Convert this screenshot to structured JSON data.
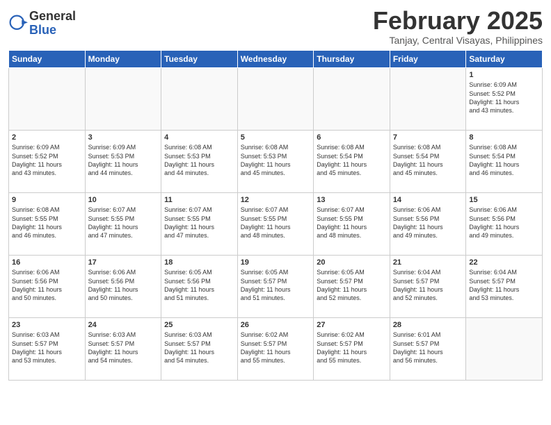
{
  "header": {
    "logo_general": "General",
    "logo_blue": "Blue",
    "month_title": "February 2025",
    "location": "Tanjay, Central Visayas, Philippines"
  },
  "days_of_week": [
    "Sunday",
    "Monday",
    "Tuesday",
    "Wednesday",
    "Thursday",
    "Friday",
    "Saturday"
  ],
  "weeks": [
    [
      {
        "day": "",
        "info": ""
      },
      {
        "day": "",
        "info": ""
      },
      {
        "day": "",
        "info": ""
      },
      {
        "day": "",
        "info": ""
      },
      {
        "day": "",
        "info": ""
      },
      {
        "day": "",
        "info": ""
      },
      {
        "day": "1",
        "info": "Sunrise: 6:09 AM\nSunset: 5:52 PM\nDaylight: 11 hours\nand 43 minutes."
      }
    ],
    [
      {
        "day": "2",
        "info": "Sunrise: 6:09 AM\nSunset: 5:52 PM\nDaylight: 11 hours\nand 43 minutes."
      },
      {
        "day": "3",
        "info": "Sunrise: 6:09 AM\nSunset: 5:53 PM\nDaylight: 11 hours\nand 44 minutes."
      },
      {
        "day": "4",
        "info": "Sunrise: 6:08 AM\nSunset: 5:53 PM\nDaylight: 11 hours\nand 44 minutes."
      },
      {
        "day": "5",
        "info": "Sunrise: 6:08 AM\nSunset: 5:53 PM\nDaylight: 11 hours\nand 45 minutes."
      },
      {
        "day": "6",
        "info": "Sunrise: 6:08 AM\nSunset: 5:54 PM\nDaylight: 11 hours\nand 45 minutes."
      },
      {
        "day": "7",
        "info": "Sunrise: 6:08 AM\nSunset: 5:54 PM\nDaylight: 11 hours\nand 45 minutes."
      },
      {
        "day": "8",
        "info": "Sunrise: 6:08 AM\nSunset: 5:54 PM\nDaylight: 11 hours\nand 46 minutes."
      }
    ],
    [
      {
        "day": "9",
        "info": "Sunrise: 6:08 AM\nSunset: 5:55 PM\nDaylight: 11 hours\nand 46 minutes."
      },
      {
        "day": "10",
        "info": "Sunrise: 6:07 AM\nSunset: 5:55 PM\nDaylight: 11 hours\nand 47 minutes."
      },
      {
        "day": "11",
        "info": "Sunrise: 6:07 AM\nSunset: 5:55 PM\nDaylight: 11 hours\nand 47 minutes."
      },
      {
        "day": "12",
        "info": "Sunrise: 6:07 AM\nSunset: 5:55 PM\nDaylight: 11 hours\nand 48 minutes."
      },
      {
        "day": "13",
        "info": "Sunrise: 6:07 AM\nSunset: 5:55 PM\nDaylight: 11 hours\nand 48 minutes."
      },
      {
        "day": "14",
        "info": "Sunrise: 6:06 AM\nSunset: 5:56 PM\nDaylight: 11 hours\nand 49 minutes."
      },
      {
        "day": "15",
        "info": "Sunrise: 6:06 AM\nSunset: 5:56 PM\nDaylight: 11 hours\nand 49 minutes."
      }
    ],
    [
      {
        "day": "16",
        "info": "Sunrise: 6:06 AM\nSunset: 5:56 PM\nDaylight: 11 hours\nand 50 minutes."
      },
      {
        "day": "17",
        "info": "Sunrise: 6:06 AM\nSunset: 5:56 PM\nDaylight: 11 hours\nand 50 minutes."
      },
      {
        "day": "18",
        "info": "Sunrise: 6:05 AM\nSunset: 5:56 PM\nDaylight: 11 hours\nand 51 minutes."
      },
      {
        "day": "19",
        "info": "Sunrise: 6:05 AM\nSunset: 5:57 PM\nDaylight: 11 hours\nand 51 minutes."
      },
      {
        "day": "20",
        "info": "Sunrise: 6:05 AM\nSunset: 5:57 PM\nDaylight: 11 hours\nand 52 minutes."
      },
      {
        "day": "21",
        "info": "Sunrise: 6:04 AM\nSunset: 5:57 PM\nDaylight: 11 hours\nand 52 minutes."
      },
      {
        "day": "22",
        "info": "Sunrise: 6:04 AM\nSunset: 5:57 PM\nDaylight: 11 hours\nand 53 minutes."
      }
    ],
    [
      {
        "day": "23",
        "info": "Sunrise: 6:03 AM\nSunset: 5:57 PM\nDaylight: 11 hours\nand 53 minutes."
      },
      {
        "day": "24",
        "info": "Sunrise: 6:03 AM\nSunset: 5:57 PM\nDaylight: 11 hours\nand 54 minutes."
      },
      {
        "day": "25",
        "info": "Sunrise: 6:03 AM\nSunset: 5:57 PM\nDaylight: 11 hours\nand 54 minutes."
      },
      {
        "day": "26",
        "info": "Sunrise: 6:02 AM\nSunset: 5:57 PM\nDaylight: 11 hours\nand 55 minutes."
      },
      {
        "day": "27",
        "info": "Sunrise: 6:02 AM\nSunset: 5:57 PM\nDaylight: 11 hours\nand 55 minutes."
      },
      {
        "day": "28",
        "info": "Sunrise: 6:01 AM\nSunset: 5:57 PM\nDaylight: 11 hours\nand 56 minutes."
      },
      {
        "day": "",
        "info": ""
      }
    ]
  ]
}
